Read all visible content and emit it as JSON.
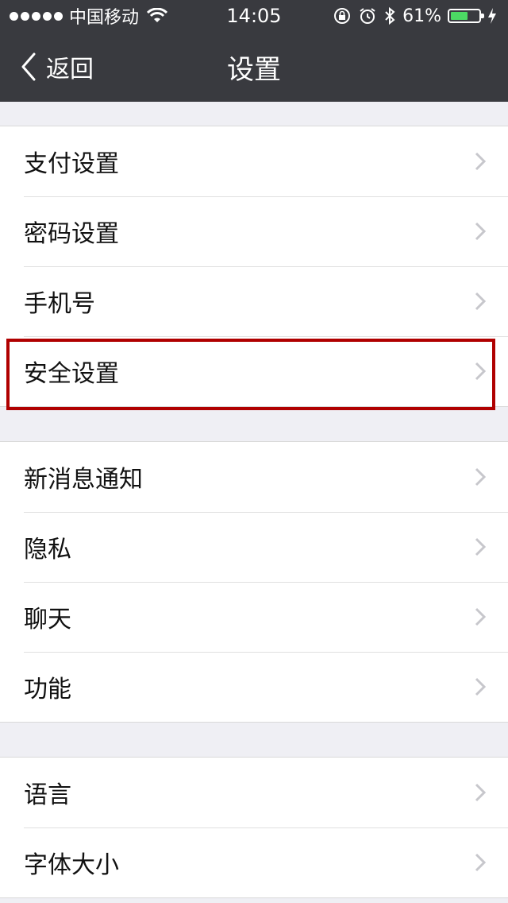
{
  "status_bar": {
    "carrier": "中国移动",
    "time": "14:05",
    "battery": "61%",
    "battery_level": 0.61
  },
  "nav": {
    "back_label": "返回",
    "title": "设置"
  },
  "groups": [
    {
      "items": [
        {
          "label": "支付设置"
        },
        {
          "label": "密码设置"
        },
        {
          "label": "手机号"
        },
        {
          "label": "安全设置",
          "highlighted": true
        }
      ]
    },
    {
      "items": [
        {
          "label": "新消息通知"
        },
        {
          "label": "隐私"
        },
        {
          "label": "聊天"
        },
        {
          "label": "功能"
        }
      ]
    },
    {
      "items": [
        {
          "label": "语言"
        },
        {
          "label": "字体大小"
        }
      ]
    }
  ],
  "colors": {
    "nav_background": "#393a3f",
    "page_background": "#efeff4",
    "highlight_border": "#b00000",
    "battery_fill": "#4cd964"
  },
  "icons": [
    "signal-dots-icon",
    "wifi-icon",
    "rotation-lock-icon",
    "alarm-icon",
    "bluetooth-icon",
    "battery-icon",
    "charging-icon",
    "back-chevron-icon",
    "chevron-right-icon"
  ]
}
